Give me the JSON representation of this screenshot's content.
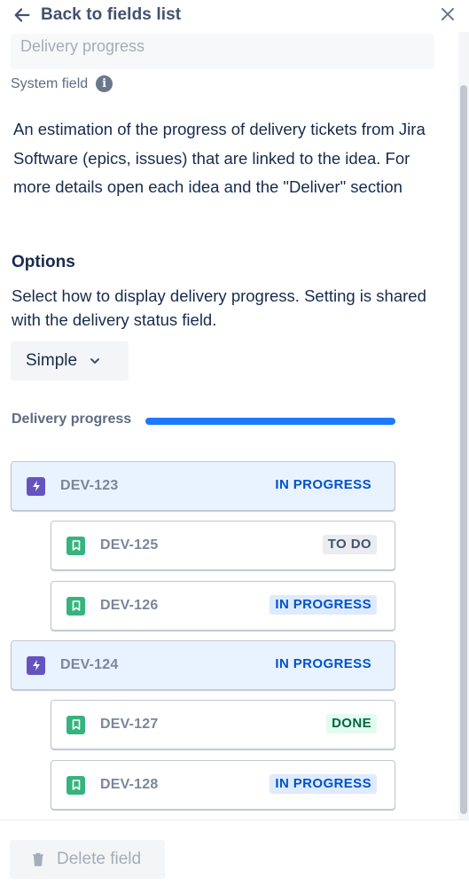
{
  "header": {
    "back_label": "Back to fields list"
  },
  "field": {
    "name": "Delivery progress",
    "system_label": "System field",
    "info_glyph": "i",
    "description": "An estimation of the progress of delivery tickets from Jira Software (epics, issues) that are linked to the idea. For more details open each idea and the \"Deliver\" section"
  },
  "options": {
    "title": "Options",
    "description": "Select how to display delivery progress. Setting is shared with the delivery status field.",
    "selected": "Simple"
  },
  "delivery_progress": {
    "label": "Delivery progress",
    "progress": 1.0
  },
  "issues": [
    {
      "key": "DEV-123",
      "type": "epic",
      "status": "IN PROGRESS"
    },
    {
      "key": "DEV-125",
      "type": "story",
      "status": "TO DO"
    },
    {
      "key": "DEV-126",
      "type": "story",
      "status": "IN PROGRESS"
    },
    {
      "key": "DEV-124",
      "type": "epic",
      "status": "IN PROGRESS"
    },
    {
      "key": "DEV-127",
      "type": "story",
      "status": "DONE"
    },
    {
      "key": "DEV-128",
      "type": "story",
      "status": "IN PROGRESS"
    }
  ],
  "footer": {
    "delete_label": "Delete field"
  },
  "colors": {
    "accent": "#1d7afc",
    "epic": "#6554c0",
    "story": "#36b37e",
    "in_progress": "#0052cc",
    "done": "#006644"
  },
  "icons": [
    "arrow-left-icon",
    "close-icon",
    "info-icon",
    "chevron-down-icon",
    "lightning-icon",
    "bookmark-icon",
    "trash-icon"
  ]
}
